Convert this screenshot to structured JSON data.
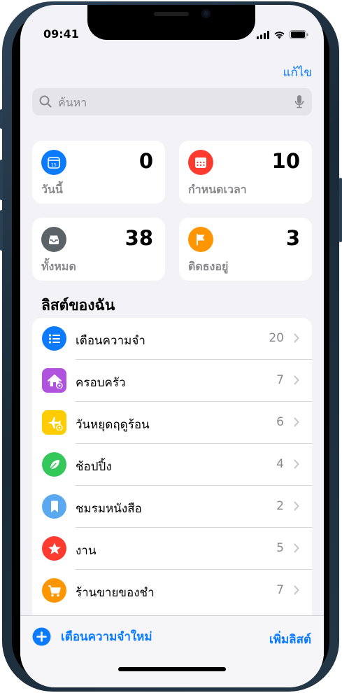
{
  "status": {
    "time": "09:41"
  },
  "header": {
    "edit_label": "แก้ไข"
  },
  "search": {
    "placeholder": "ค้นหา"
  },
  "smart_lists": [
    {
      "label": "วันนี้",
      "count": "0",
      "color": "#0a7aff",
      "icon": "calendar-today-icon"
    },
    {
      "label": "กำหนดเวลา",
      "count": "10",
      "color": "#ff3b30",
      "icon": "calendar-grid-icon"
    },
    {
      "label": "ทั้งหมด",
      "count": "38",
      "color": "#5b6369",
      "icon": "tray-icon"
    },
    {
      "label": "ติดธงอยู่",
      "count": "3",
      "color": "#ff9500",
      "icon": "flag-icon"
    }
  ],
  "my_lists": {
    "title": "ลิสต์ของฉัน",
    "items": [
      {
        "name": "เตือนความจำ",
        "count": "20",
        "color": "#0a7aff",
        "icon": "list-bullet-icon"
      },
      {
        "name": "ครอบครัว",
        "count": "7",
        "color": "#af52de",
        "icon": "house-icon"
      },
      {
        "name": "วันหยุดฤดูร้อน",
        "count": "6",
        "color": "#ffcc00",
        "icon": "airplane-icon"
      },
      {
        "name": "ช้อปปิ้ง",
        "count": "4",
        "color": "#34c759",
        "icon": "leaf-icon"
      },
      {
        "name": "ชมรมหนังสือ",
        "count": "2",
        "color": "#5aa9f0",
        "icon": "bookmark-icon"
      },
      {
        "name": "งาน",
        "count": "5",
        "color": "#ff3b30",
        "icon": "star-icon"
      },
      {
        "name": "ร้านขายของชำ",
        "count": "7",
        "color": "#ff9500",
        "icon": "cart-icon"
      }
    ]
  },
  "toolbar": {
    "new_reminder": "เตือนความจำใหม่",
    "add_list": "เพิ่มลิสต์"
  }
}
